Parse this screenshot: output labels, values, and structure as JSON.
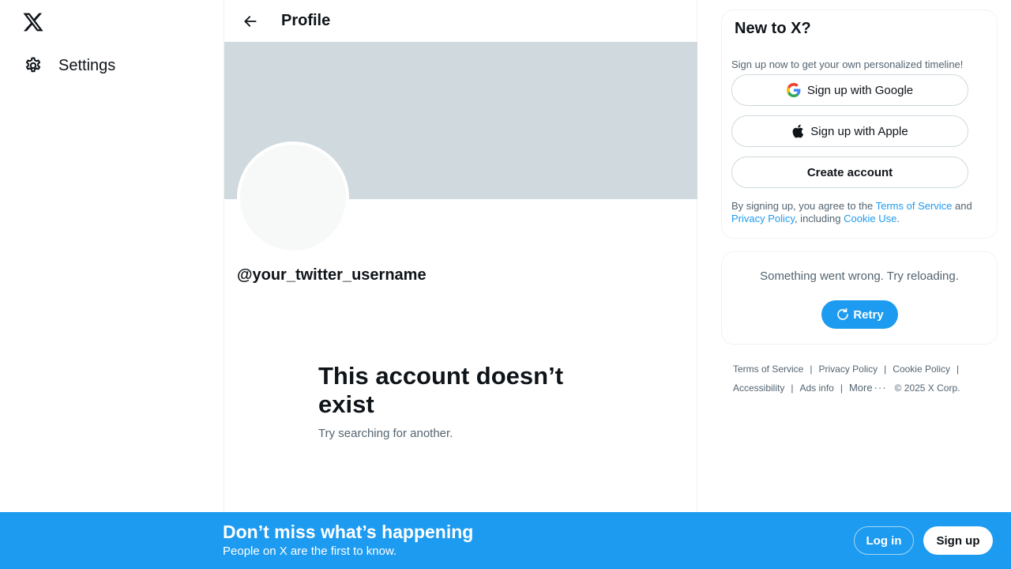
{
  "sidebar": {
    "logo_icon": "x-logo-icon",
    "settings": {
      "label": "Settings",
      "icon": "gear-icon"
    }
  },
  "main": {
    "header": {
      "title": "Profile",
      "back_icon": "arrow-left-icon"
    },
    "banner_color": "#cfd9de",
    "avatar_color": "#f7f9f9",
    "handle": "@your_twitter_username",
    "empty_state": {
      "heading": "This account doesn’t exist",
      "subtext": "Try searching for another."
    }
  },
  "right": {
    "signup_card": {
      "title": "New to X?",
      "description": "Sign up now to get your own personalized timeline!",
      "google_label": "Sign up with Google",
      "apple_label": "Sign up with Apple",
      "create_label": "Create account",
      "legal": {
        "prefix": "By signing up, you agree to the ",
        "terms": "Terms of Service",
        "and": " and ",
        "privacy": "Privacy Policy",
        "including": ", including ",
        "cookie": "Cookie Use",
        "suffix": "."
      }
    },
    "error_card": {
      "message": "Something went wrong. Try reloading.",
      "retry_label": "Retry"
    },
    "footer": {
      "terms": "Terms of Service",
      "privacy": "Privacy Policy",
      "cookie": "Cookie Policy",
      "accessibility": "Accessibility",
      "ads": "Ads info",
      "more": "More",
      "copyright": "© 2025 X Corp."
    }
  },
  "bottom_bar": {
    "title": "Don’t miss what’s happening",
    "subtitle": "People on X are the first to know.",
    "login_label": "Log in",
    "signup_label": "Sign up",
    "color": "#1d9bf0"
  }
}
